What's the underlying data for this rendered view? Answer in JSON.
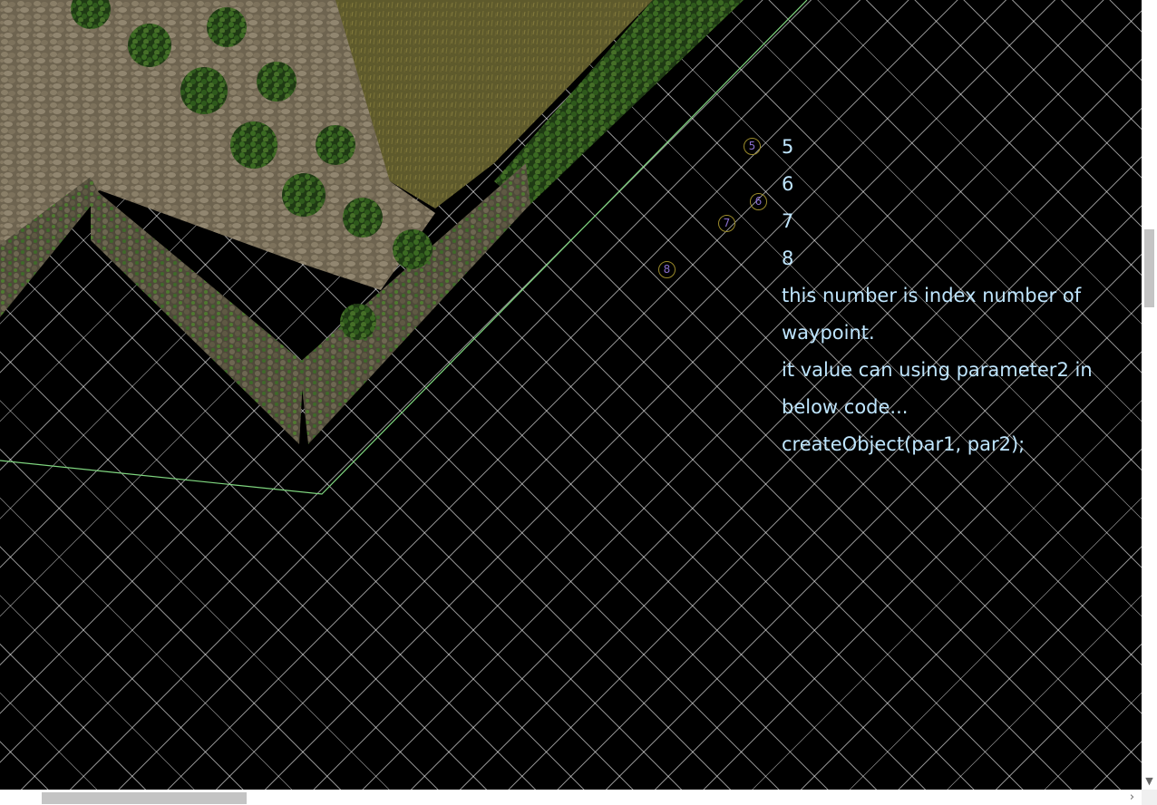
{
  "waypoints": [
    {
      "index": "5"
    },
    {
      "index": "6"
    },
    {
      "index": "7"
    },
    {
      "index": "8"
    }
  ],
  "annotation": {
    "lines": [
      "5",
      "6",
      "7",
      "8",
      "this number is index number of",
      "waypoint.",
      "it value can using parameter2 in",
      "below code...",
      "createObject(par1, par2);"
    ]
  },
  "colors": {
    "background": "#000000",
    "grid": "#ffffff",
    "boundary_line": "#7fd67f",
    "annotation_text": "#bfe6ff",
    "marker_ring": "#9a8a2a",
    "marker_text": "#8a6fd0"
  }
}
